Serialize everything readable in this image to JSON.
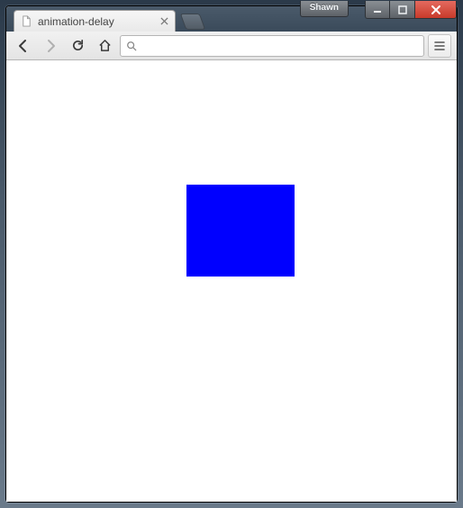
{
  "os": {
    "username": "Shawn"
  },
  "browser": {
    "tab_title": "animation-delay",
    "omnibox_value": "",
    "omnibox_placeholder": ""
  },
  "page": {
    "square_color": "#0000ff"
  }
}
